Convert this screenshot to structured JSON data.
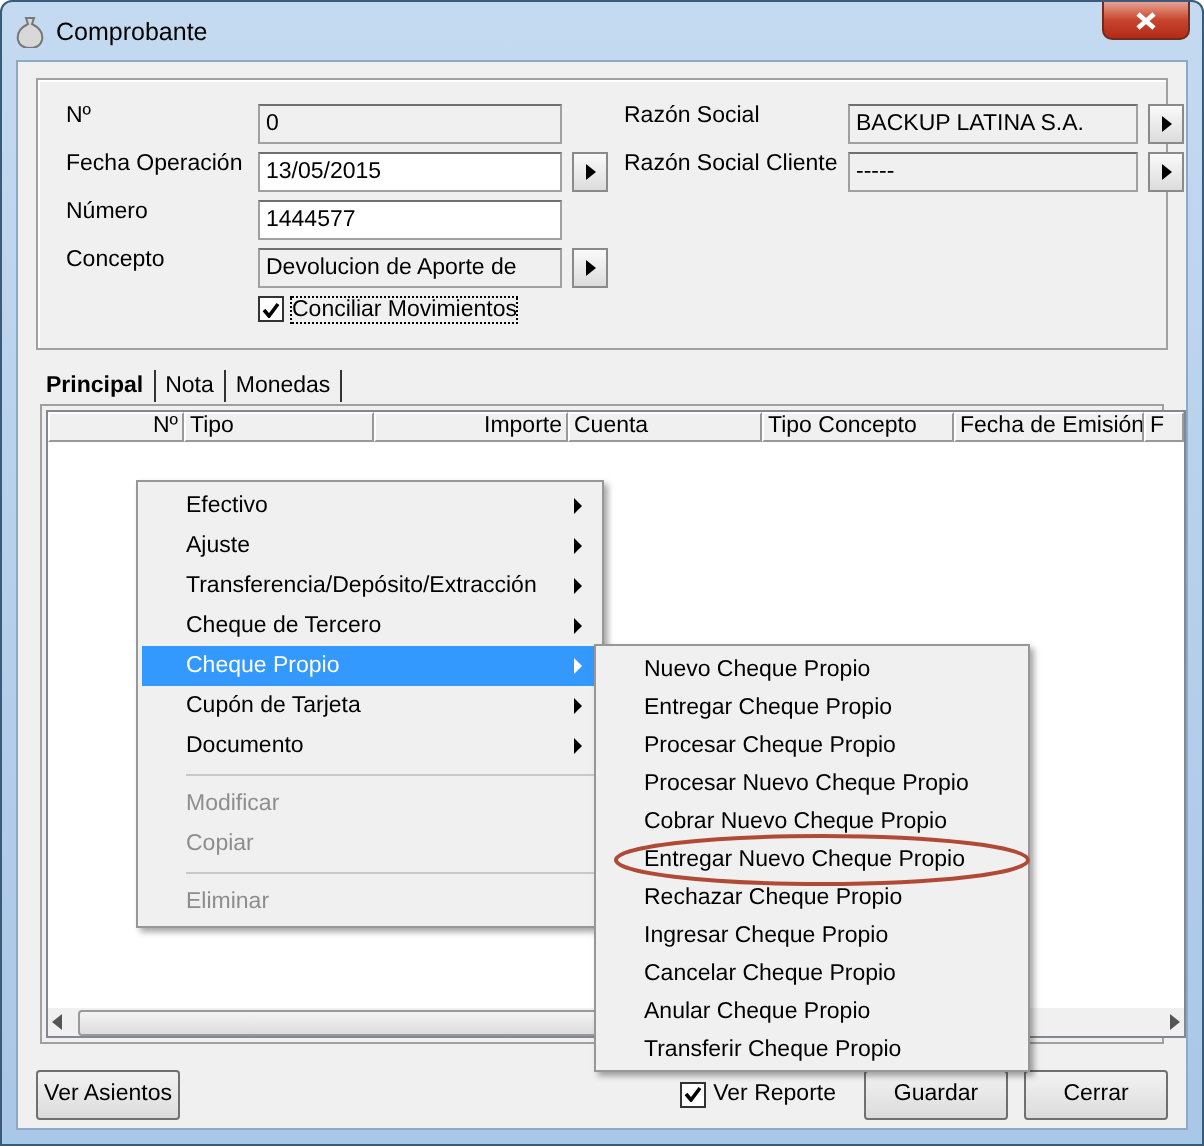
{
  "window": {
    "title": "Comprobante"
  },
  "form": {
    "left": [
      {
        "label": "Nº",
        "value": "0",
        "readonly": true,
        "has_button": false
      },
      {
        "label": "Fecha Operación",
        "value": "13/05/2015",
        "readonly": false,
        "has_button": true
      },
      {
        "label": "Número",
        "value": "1444577",
        "readonly": false,
        "has_button": false
      },
      {
        "label": "Concepto",
        "value": "Devolucion de Aporte de",
        "readonly": true,
        "has_button": true
      }
    ],
    "right": [
      {
        "label": "Razón Social",
        "value": "BACKUP LATINA S.A.",
        "readonly": true,
        "has_button": true
      },
      {
        "label": "Razón Social Cliente",
        "value": "-----",
        "readonly": true,
        "has_button": true
      }
    ],
    "checkbox": {
      "label": "Conciliar Movimientos",
      "checked": true
    }
  },
  "tabs": [
    {
      "label": "Principal",
      "selected": true
    },
    {
      "label": "Nota",
      "selected": false
    },
    {
      "label": "Monedas",
      "selected": false
    }
  ],
  "table": {
    "columns": [
      {
        "label": "Nº"
      },
      {
        "label": "Tipo"
      },
      {
        "label": "Importe"
      },
      {
        "label": "Cuenta"
      },
      {
        "label": "Tipo Concepto"
      },
      {
        "label": "Fecha de Emisión"
      },
      {
        "label": "F"
      }
    ]
  },
  "context_menu": [
    {
      "kind": "item",
      "label": "Efectivo",
      "submenu": true,
      "selected": false,
      "disabled": false
    },
    {
      "kind": "item",
      "label": "Ajuste",
      "submenu": true,
      "selected": false,
      "disabled": false
    },
    {
      "kind": "item",
      "label": "Transferencia/Depósito/Extracción",
      "submenu": true,
      "selected": false,
      "disabled": false
    },
    {
      "kind": "item",
      "label": "Cheque de Tercero",
      "submenu": true,
      "selected": false,
      "disabled": false
    },
    {
      "kind": "item",
      "label": "Cheque Propio",
      "submenu": true,
      "selected": true,
      "disabled": false
    },
    {
      "kind": "item",
      "label": "Cupón de Tarjeta",
      "submenu": true,
      "selected": false,
      "disabled": false
    },
    {
      "kind": "item",
      "label": "Documento",
      "submenu": true,
      "selected": false,
      "disabled": false
    },
    {
      "kind": "separator"
    },
    {
      "kind": "item",
      "label": "Modificar",
      "submenu": false,
      "selected": false,
      "disabled": true
    },
    {
      "kind": "item",
      "label": "Copiar",
      "submenu": false,
      "selected": false,
      "disabled": true
    },
    {
      "kind": "separator"
    },
    {
      "kind": "item",
      "label": "Eliminar",
      "submenu": false,
      "selected": false,
      "disabled": true
    }
  ],
  "submenu": [
    {
      "label": "Nuevo Cheque Propio",
      "circled": false
    },
    {
      "label": "Entregar Cheque Propio",
      "circled": false
    },
    {
      "label": "Procesar Cheque Propio",
      "circled": false
    },
    {
      "label": "Procesar Nuevo Cheque Propio",
      "circled": false
    },
    {
      "label": "Cobrar Nuevo Cheque Propio",
      "circled": false
    },
    {
      "label": "Entregar Nuevo Cheque Propio",
      "circled": true
    },
    {
      "label": "Rechazar Cheque Propio",
      "circled": false
    },
    {
      "label": "Ingresar Cheque Propio",
      "circled": false
    },
    {
      "label": "Cancelar Cheque Propio",
      "circled": false
    },
    {
      "label": "Anular Cheque Propio",
      "circled": false
    },
    {
      "label": "Transferir Cheque Propio",
      "circled": false
    }
  ],
  "footer": {
    "left_button": "Ver Asientos",
    "checkbox": {
      "label": "Ver Reporte",
      "checked": true
    },
    "buttons": [
      "Guardar",
      "Cerrar"
    ]
  }
}
